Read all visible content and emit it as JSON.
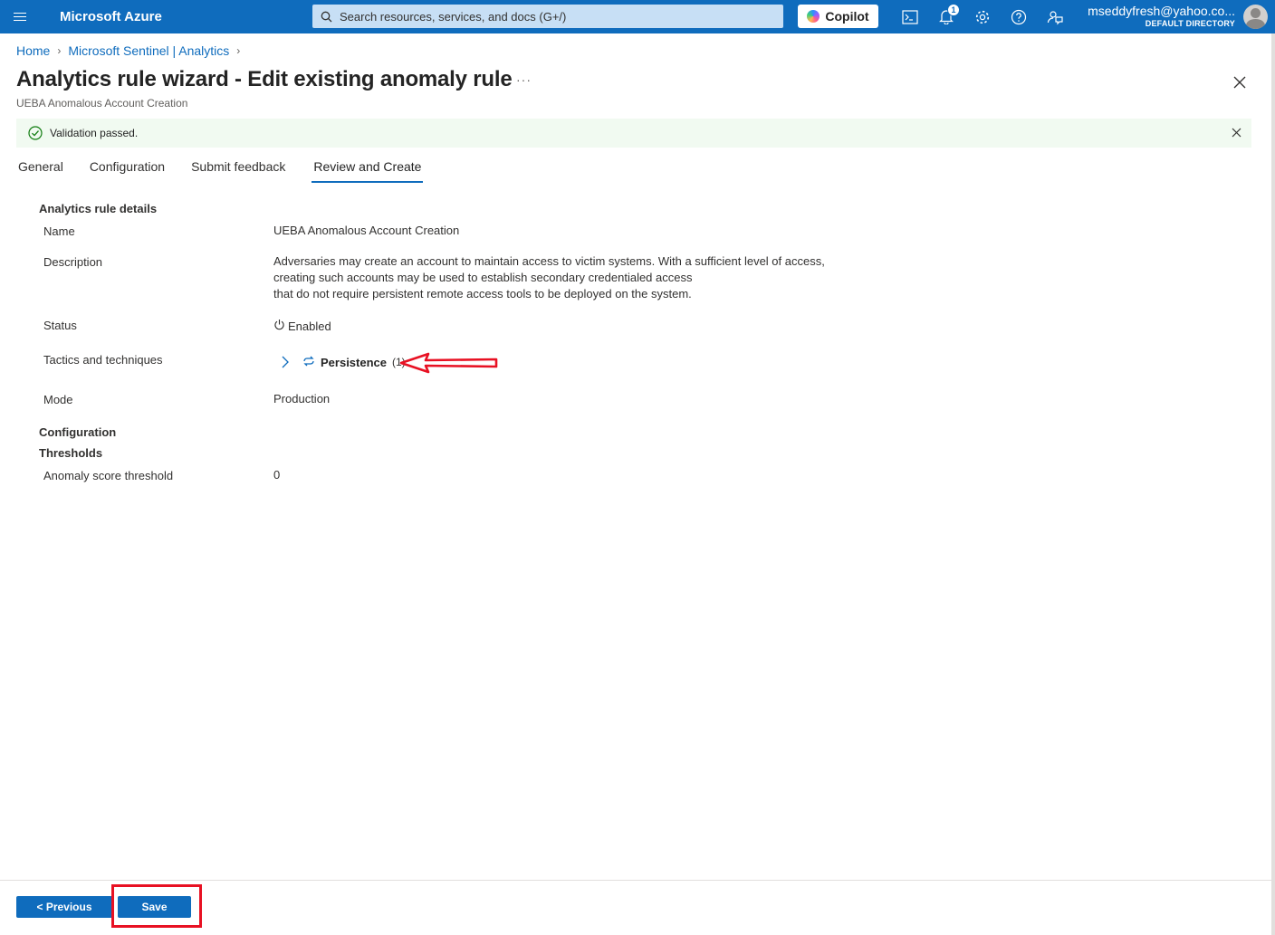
{
  "topbar": {
    "brand": "Microsoft Azure",
    "search_placeholder": "Search resources, services, and docs (G+/)",
    "copilot_label": "Copilot",
    "notification_count": "1",
    "account_email": "mseddyfresh@yahoo.co...",
    "account_directory": "DEFAULT DIRECTORY"
  },
  "breadcrumb": [
    {
      "label": "Home"
    },
    {
      "label": "Microsoft Sentinel | Analytics"
    }
  ],
  "page": {
    "title": "Analytics rule wizard - Edit existing anomaly rule",
    "more": "···",
    "subtitle": "UEBA Anomalous Account Creation"
  },
  "validation": {
    "message": "Validation passed."
  },
  "tabs": [
    {
      "label": "General"
    },
    {
      "label": "Configuration"
    },
    {
      "label": "Submit feedback"
    },
    {
      "label": "Review and Create",
      "active": true
    }
  ],
  "details": {
    "section_title": "Analytics rule details",
    "name_label": "Name",
    "name_value": "UEBA Anomalous Account Creation",
    "description_label": "Description",
    "description_lines": [
      "Adversaries may create an account to maintain access to victim systems. With a sufficient level of access,",
      "creating such accounts may be used to establish secondary credentialed access",
      "that do not require persistent remote access tools to be deployed on the system."
    ],
    "status_label": "Status",
    "status_value": "Enabled",
    "tactics_label": "Tactics and techniques",
    "tactic_name": "Persistence",
    "tactic_count": "(1)",
    "mode_label": "Mode",
    "mode_value": "Production"
  },
  "configuration": {
    "section_title": "Configuration",
    "thresholds_title": "Thresholds",
    "anomaly_label": "Anomaly score threshold",
    "anomaly_value": "0"
  },
  "footer": {
    "previous_label": "< Previous",
    "save_label": "Save"
  },
  "colors": {
    "accent": "#0f6cbd",
    "success": "#107c10",
    "annotation": "#e81123"
  }
}
